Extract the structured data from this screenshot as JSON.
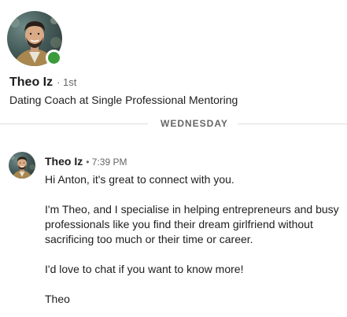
{
  "profile": {
    "name": "Theo Iz",
    "degree": "· 1st",
    "headline": "Dating Coach at Single Professional Mentoring",
    "online": true
  },
  "divider": {
    "label": "WEDNESDAY"
  },
  "message": {
    "sender": "Theo Iz",
    "time": "• 7:39 PM",
    "paragraphs": [
      "Hi Anton, it's great to connect with you.",
      "I'm Theo, and I specialise in helping entrepreneurs and busy professionals like you find their dream girlfriend without sacrificing too much or their time or career.",
      "I'd love to chat if you want to know more!",
      "Theo"
    ]
  },
  "colors": {
    "presence_green": "#3b9b3b",
    "text_primary": "#1d1d1d",
    "text_secondary": "#666666",
    "divider": "#dcdcdc"
  }
}
